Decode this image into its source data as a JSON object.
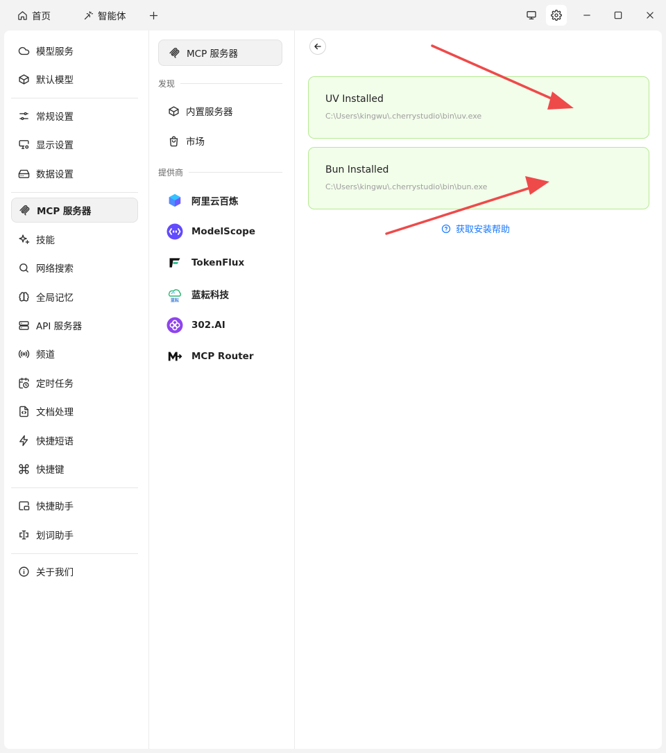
{
  "titlebar": {
    "tabs": [
      {
        "label": "首页",
        "icon": "home-icon"
      },
      {
        "label": "智能体",
        "icon": "sparkle-wand-icon"
      }
    ],
    "add_tab_icon": "plus-icon",
    "buttons": [
      "monitor-icon",
      "gear-icon"
    ],
    "window_controls": [
      "minimize-icon",
      "maximize-icon",
      "close-icon"
    ]
  },
  "settings_nav": {
    "items": [
      {
        "label": "模型服务",
        "icon": "cloud-icon"
      },
      {
        "label": "默认模型",
        "icon": "cube-icon"
      },
      {
        "label": "常规设置",
        "icon": "sliders-icon"
      },
      {
        "label": "显示设置",
        "icon": "display-settings-icon"
      },
      {
        "label": "数据设置",
        "icon": "hard-drive-icon"
      },
      {
        "label": "MCP 服务器",
        "icon": "mcp-icon",
        "active": true
      },
      {
        "label": "技能",
        "icon": "sparkles-icon"
      },
      {
        "label": "网络搜索",
        "icon": "search-icon"
      },
      {
        "label": "全局记忆",
        "icon": "brain-icon"
      },
      {
        "label": "API 服务器",
        "icon": "server-icon"
      },
      {
        "label": "频道",
        "icon": "radio-icon"
      },
      {
        "label": "定时任务",
        "icon": "calendar-clock-icon"
      },
      {
        "label": "文档处理",
        "icon": "file-code-icon"
      },
      {
        "label": "快捷短语",
        "icon": "zap-icon"
      },
      {
        "label": "快捷键",
        "icon": "command-icon"
      },
      {
        "label": "快捷助手",
        "icon": "picture-in-picture-icon"
      },
      {
        "label": "划词助手",
        "icon": "text-cursor-icon"
      },
      {
        "label": "关于我们",
        "icon": "info-icon"
      }
    ]
  },
  "mcp_menu": {
    "header": "MCP 服务器",
    "discover_title": "发现",
    "discover": [
      {
        "label": "内置服务器",
        "icon": "package-icon"
      },
      {
        "label": "市场",
        "icon": "shopping-bag-icon"
      }
    ],
    "providers_title": "提供商",
    "providers": [
      {
        "label": "阿里云百炼",
        "logo": "bailian-logo"
      },
      {
        "label": "ModelScope",
        "logo": "modelscope-logo"
      },
      {
        "label": "TokenFlux",
        "logo": "tokenflux-logo"
      },
      {
        "label": "蓝耘科技",
        "logo": "lanyun-logo",
        "logo_text": "蓝耘"
      },
      {
        "label": "302.AI",
        "logo": "302ai-logo"
      },
      {
        "label": "MCP Router",
        "logo": "mcp-router-logo"
      }
    ]
  },
  "install_status": {
    "back_icon": "arrow-left-icon",
    "cards": [
      {
        "title": "UV Installed",
        "path": "C:\\Users\\kingwu\\.cherrystudio\\bin\\uv.exe"
      },
      {
        "title": "Bun Installed",
        "path": "C:\\Users\\kingwu\\.cherrystudio\\bin\\bun.exe"
      }
    ],
    "help_link": "获取安装帮助",
    "help_icon": "help-circle-icon"
  },
  "colors": {
    "accent_link": "#1677ff",
    "card_bg": "#f2fdea",
    "card_border": "#b6eb93",
    "annotation_arrow": "#ee4a4a"
  }
}
